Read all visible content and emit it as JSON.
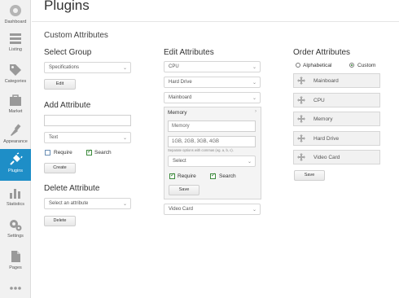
{
  "sidebar": {
    "items": [
      {
        "label": "Dashboard",
        "icon": "dashboard-icon"
      },
      {
        "label": "Listing",
        "icon": "list-icon"
      },
      {
        "label": "Categories",
        "icon": "tags-icon"
      },
      {
        "label": "Market",
        "icon": "market-icon"
      },
      {
        "label": "Appearance",
        "icon": "brush-icon"
      },
      {
        "label": "Plugins",
        "icon": "plug-icon"
      },
      {
        "label": "Statistics",
        "icon": "bar-chart-icon"
      },
      {
        "label": "Settings",
        "icon": "gears-icon"
      },
      {
        "label": "Pages",
        "icon": "pages-icon"
      },
      {
        "label": "",
        "icon": "more-icon"
      }
    ],
    "active_color": "#1e8ec7"
  },
  "header": {
    "title": "Plugins"
  },
  "section": {
    "title": "Custom Attributes"
  },
  "select_group": {
    "title": "Select Group",
    "value": "Specifications",
    "edit_label": "Edit"
  },
  "add_attribute": {
    "title": "Add Attribute",
    "name_value": "",
    "type_value": "Text",
    "require_label": "Require",
    "search_label": "Search",
    "create_label": "Create"
  },
  "delete_attribute": {
    "title": "Delete Attribute",
    "select_placeholder": "Select an attribute",
    "delete_label": "Delete"
  },
  "edit_attributes": {
    "title": "Edit Attributes",
    "items": [
      "CPU",
      "Hard Drive",
      "Mainboard"
    ],
    "panel": {
      "name": "Memory",
      "name_value": "Memory",
      "options_value": "1GB, 2GB, 3GB, 4GB",
      "options_hint": "Separate options with commas (eg. a, b, c).",
      "select_value": "Select",
      "require_label": "Require",
      "search_label": "Search",
      "save_label": "Save"
    },
    "last_item": "Video Card"
  },
  "order_attributes": {
    "title": "Order Attributes",
    "alphabetical_label": "Alphabetical",
    "custom_label": "Custom",
    "items": [
      "Mainboard",
      "CPU",
      "Memory",
      "Hard Drive",
      "Video Card"
    ],
    "save_label": "Save"
  }
}
